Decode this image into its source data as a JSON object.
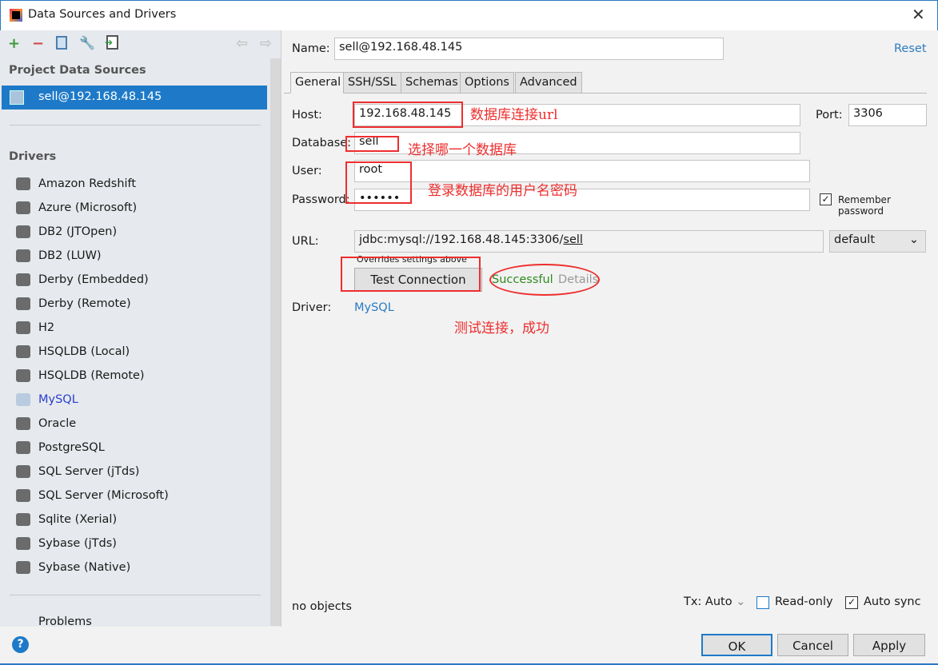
{
  "window": {
    "title": "Data Sources and Drivers",
    "close": "✕"
  },
  "sidebar": {
    "section_project": "Project Data Sources",
    "selected_source": "sell@192.168.48.145",
    "section_drivers": "Drivers",
    "drivers": [
      {
        "label": "Amazon Redshift",
        "icon": "redshift-icon"
      },
      {
        "label": "Azure (Microsoft)",
        "icon": "windows-icon"
      },
      {
        "label": "DB2 (JTOpen)",
        "icon": "ibm-icon"
      },
      {
        "label": "DB2 (LUW)",
        "icon": "ibm-icon"
      },
      {
        "label": "Derby (Embedded)",
        "icon": "derby-hat-icon"
      },
      {
        "label": "Derby (Remote)",
        "icon": "derby-hat-icon"
      },
      {
        "label": "H2",
        "icon": "h2-icon"
      },
      {
        "label": "HSQLDB (Local)",
        "icon": "hsqldb-icon"
      },
      {
        "label": "HSQLDB (Remote)",
        "icon": "hsqldb-icon"
      },
      {
        "label": "MySQL",
        "icon": "mysql-icon"
      },
      {
        "label": "Oracle",
        "icon": "oracle-icon"
      },
      {
        "label": "PostgreSQL",
        "icon": "postgresql-icon"
      },
      {
        "label": "SQL Server (jTds)",
        "icon": "sqlserver-icon"
      },
      {
        "label": "SQL Server (Microsoft)",
        "icon": "sqlserver-icon"
      },
      {
        "label": "Sqlite (Xerial)",
        "icon": "sqlite-icon"
      },
      {
        "label": "Sybase (jTds)",
        "icon": "sybase-icon"
      },
      {
        "label": "Sybase (Native)",
        "icon": "sybase-icon"
      }
    ],
    "problems": "Problems",
    "help": "?"
  },
  "form": {
    "name_label": "Name:",
    "name_value": "sell@192.168.48.145",
    "reset": "Reset",
    "tabs": [
      "General",
      "SSH/SSL",
      "Schemas",
      "Options",
      "Advanced"
    ],
    "host_label": "Host:",
    "host_value": "192.168.48.145",
    "port_label": "Port:",
    "port_value": "3306",
    "database_label": "Database:",
    "database_value": "sell",
    "user_label": "User:",
    "user_value": "root",
    "password_label": "Password:",
    "password_value": "••••••",
    "remember_password": "Remember password",
    "url_label": "URL:",
    "url_prefix": "jdbc:mysql://192.168.48.145:3306/",
    "url_db": "sell",
    "url_mode": "default",
    "overrides": "Overrides settings above",
    "test_connection": "Test Connection",
    "status": "Successful",
    "details": "Details",
    "driver_label": "Driver:",
    "driver_value": "MySQL",
    "no_objects": "no objects",
    "tx": "Tx: Auto",
    "read_only": "Read-only",
    "auto_sync": "Auto sync",
    "ok": "OK",
    "cancel": "Cancel",
    "apply": "Apply"
  },
  "annotations": {
    "host": "数据库连接url",
    "database": "选择哪一个数据库",
    "user": "登录数据库的用户名密码",
    "test": "测试连接，成功"
  },
  "colors": {
    "accent": "#1e7ac8",
    "success": "#2d8a1e",
    "annotation": "#ee2e2e",
    "link": "#2b7bc0"
  }
}
